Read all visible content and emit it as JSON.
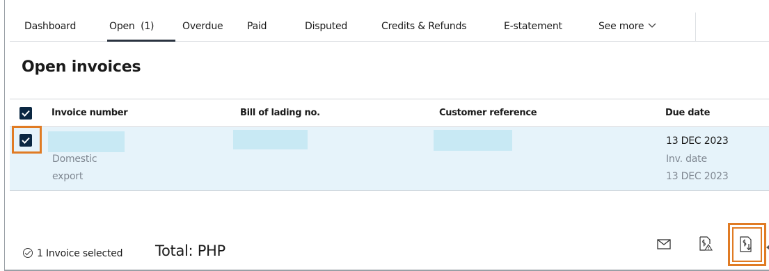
{
  "tabs": [
    {
      "label": "Dashboard"
    },
    {
      "label": "Open  (1)"
    },
    {
      "label": "Overdue"
    },
    {
      "label": "Paid"
    },
    {
      "label": "Disputed"
    },
    {
      "label": "Credits & Refunds"
    },
    {
      "label": "E-statement"
    },
    {
      "label": "See more"
    }
  ],
  "active_tab": "Open  (1)",
  "page_title": "Open invoices",
  "table": {
    "headers": [
      "Invoice number",
      "Bill of lading no.",
      "Customer reference",
      "Due date"
    ],
    "rows": [
      {
        "selected": true,
        "invoice_type_line1": "Domestic",
        "invoice_type_line2": "export",
        "due_date": "13 DEC 2023",
        "inv_date_label": "Inv. date",
        "inv_date": "13 DEC 2023"
      }
    ]
  },
  "footer": {
    "selected_text": "1 Invoice selected",
    "total_text": "Total: PHP"
  },
  "actions": [
    {
      "icon": "mail-icon"
    },
    {
      "icon": "dispute-invoice-icon"
    },
    {
      "icon": "download-invoice-icon"
    }
  ],
  "colors": {
    "accent_highlight": "#e07b24",
    "checkbox": "#0b2742",
    "selected_row": "#e6f3fa",
    "redaction": "#c8e9f4"
  }
}
